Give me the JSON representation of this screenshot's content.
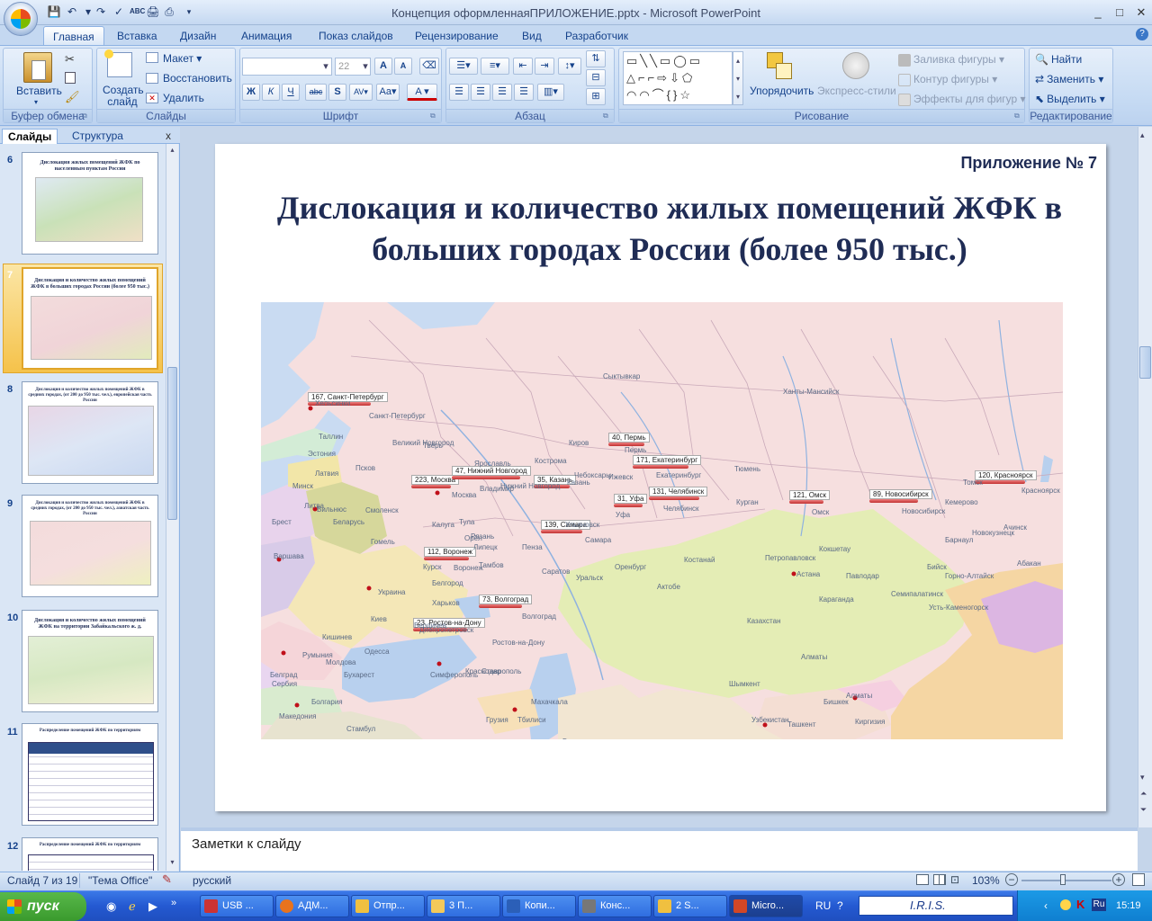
{
  "window": {
    "title": "Концепция оформленнаяПРИЛОЖЕНИЕ.pptx - Microsoft PowerPoint",
    "min": "_",
    "max": "□",
    "close": "✕"
  },
  "tabs": [
    "Главная",
    "Вставка",
    "Дизайн",
    "Анимация",
    "Показ слайдов",
    "Рецензирование",
    "Вид",
    "Разработчик"
  ],
  "ribbon": {
    "clipboard": {
      "label": "Буфер обмена",
      "paste": "Вставить"
    },
    "slides": {
      "label": "Слайды",
      "new_slide": "Создать слайд",
      "layout": "Макет",
      "reset": "Восстановить",
      "delete": "Удалить"
    },
    "font": {
      "label": "Шрифт",
      "size": "22"
    },
    "paragraph": {
      "label": "Абзац"
    },
    "drawing": {
      "label": "Рисование",
      "arrange": "Упорядочить",
      "quick_styles": "Экспресс-стили",
      "fill": "Заливка фигуры",
      "outline": "Контур фигуры",
      "effects": "Эффекты для фигур"
    },
    "editing": {
      "label": "Редактирование",
      "find": "Найти",
      "replace": "Заменить",
      "select": "Выделить"
    }
  },
  "panel": {
    "tab_slides": "Слайды",
    "tab_outline": "Структура",
    "close": "x",
    "thumbnails": [
      {
        "num": "6",
        "title": "Дислокация жилых помещений ЖФК по населенным пунктам России"
      },
      {
        "num": "7",
        "title": "Дислокация и количество жилых помещений ЖФК в больших городах России (более 950 тыс.)"
      },
      {
        "num": "8",
        "title": "Дислокация и количество жилых помещений ЖФК в средних городах, (от 200 до 950 тыс. чел.), европейская часть России"
      },
      {
        "num": "9",
        "title": "Дислокация и количество жилых помещений ЖФК в средних городах, (от 200 до 950 тыс. чел.), азиатская часть России"
      },
      {
        "num": "10",
        "title": "Дислокация и количество жилых помещений ЖФК на территории Забайкальского ж. д."
      },
      {
        "num": "11",
        "title": "Распределение помещений ЖФК по территориям"
      },
      {
        "num": "12",
        "title": "Распределение помещений ЖФК по территориям"
      }
    ]
  },
  "slide": {
    "appendix": "Приложение № 7",
    "title": "Дислокация и количество жилых помещений ЖФК в больших городах России (более 950 тыс.)",
    "city_labels": [
      "167, Санкт-Петербург",
      "223, Москва",
      "47, Нижний Новгород",
      "35, Казань",
      "40, Пермь",
      "171, Екатеринбург",
      "31, Уфа",
      "131, Челябинск",
      "139, Самара",
      "112, Воронеж",
      "73, Волгоград",
      "23, Ростов-на-Дону",
      "121, Омск",
      "89, Новосибирск",
      "120, Красноярск"
    ],
    "map_places": [
      "Хельсинки",
      "Таллин",
      "Эстония",
      "Латвия",
      "Литва",
      "Вильнюс",
      "Беларусь",
      "Варшава",
      "Украина",
      "Киев",
      "Румыния",
      "Бухарест",
      "Белград",
      "Сербия",
      "Болгария",
      "Македония",
      "Стамбул",
      "Грузия",
      "Тбилиси",
      "Баку",
      "Казахстан",
      "Астана",
      "Караганда",
      "Алматы",
      "Бишкек",
      "Киргизия",
      "Узбекистан",
      "Ташкент",
      "Сыктывкар",
      "Ханты-Мансийск",
      "Киров",
      "Ижевск",
      "Тюмень",
      "Курган",
      "Пенза",
      "Саратов",
      "Курск",
      "Липецк",
      "Орёл",
      "Смоленск",
      "Тверь",
      "Одесса",
      "Краснодар",
      "Ставрополь",
      "Махачкала",
      "Кемерово",
      "Томск",
      "Новокузнецк",
      "Барнаул",
      "Оренбург",
      "Ярославль",
      "Владимир",
      "Калуга",
      "Тула",
      "Рязань",
      "Тамбов",
      "Белгород",
      "Бердичев",
      "Кострома",
      "Ульяновск",
      "Чебоксары",
      "Пермь",
      "Уфа",
      "Санкт-Петербург",
      "Москва",
      "Омск",
      "Новосибирск",
      "Красноярск",
      "Самара",
      "Волгоград",
      "Ростов-на-Дону",
      "Воронеж",
      "Нижний Новгород",
      "Казань",
      "Екатеринбург",
      "Челябинск",
      "Великий Новгород",
      "Псков",
      "Минск",
      "Брест",
      "Гомель",
      "Харьков",
      "Днепропетровск",
      "Симферополь",
      "Кишинев",
      "Молдова",
      "Павлодар",
      "Семипалатинск",
      "Усть-Каменогорск",
      "Актобе",
      "Уральск",
      "Костанай",
      "Петропавловск",
      "Кокшетау",
      "Алматы",
      "Шымкент",
      "Ачинск",
      "Абакан",
      "Бийск",
      "Горно-Алтайск"
    ]
  },
  "notes": {
    "placeholder": "Заметки к слайду"
  },
  "status": {
    "slide": "Слайд 7 из 19",
    "theme": "\"Тема Office\"",
    "language": "русский",
    "zoom": "103%"
  },
  "taskbar": {
    "start": "пуск",
    "items": [
      "USB ...",
      "АДМ...",
      "Отпр...",
      "3 П...",
      "Копи...",
      "Конс...",
      "2 S...",
      "Micro..."
    ],
    "lang": "RU",
    "iris": "I.R.I.S.",
    "clock": "15:19"
  }
}
